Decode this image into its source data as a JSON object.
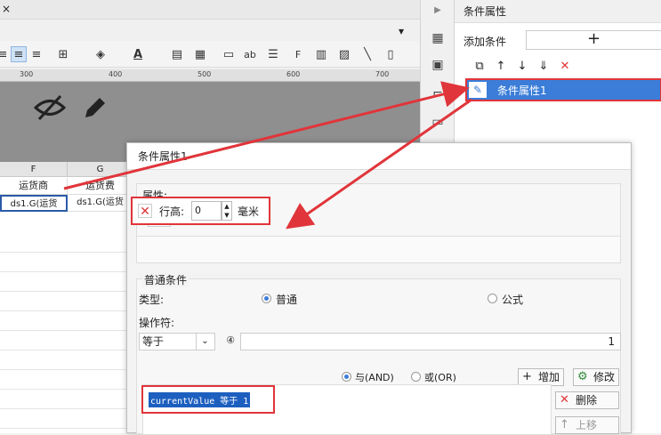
{
  "toolbar": {
    "tab_close": "×",
    "ruler_marks": [
      "300",
      "400",
      "500",
      "600",
      "700"
    ]
  },
  "grid": {
    "columns": [
      {
        "letter": "F",
        "header": "运货商",
        "formula": "ds1.G(运货"
      },
      {
        "letter": "G",
        "header": "运货费",
        "formula": "ds1.G(运货"
      }
    ]
  },
  "right_panel": {
    "title": "条件属性",
    "add_condition_label": "添加条件",
    "add_button": "+",
    "item_label": "条件属性1"
  },
  "dialog": {
    "title": "条件属性1",
    "attribute_label": "属性:",
    "add_attr_button": "+",
    "row_height_label": "行高:",
    "row_height_value": "0",
    "row_height_unit": "毫米",
    "normal_condition_label": "普通条件",
    "type_label": "类型:",
    "type_options": [
      "普通",
      "公式"
    ],
    "type_selected": "普通",
    "operator_label": "操作符:",
    "operator_value": "等于",
    "operand_value": "1",
    "and_label": "与(AND)",
    "or_label": "或(OR)",
    "logic_selected": "与(AND)",
    "add_button": "增加",
    "modify_button": "修改",
    "delete_button": "删除",
    "move_up_button": "上移",
    "condition_text": "currentValue 等于 1"
  },
  "colors": {
    "accent": "#3b7dd8",
    "highlight": "#e0353a"
  }
}
